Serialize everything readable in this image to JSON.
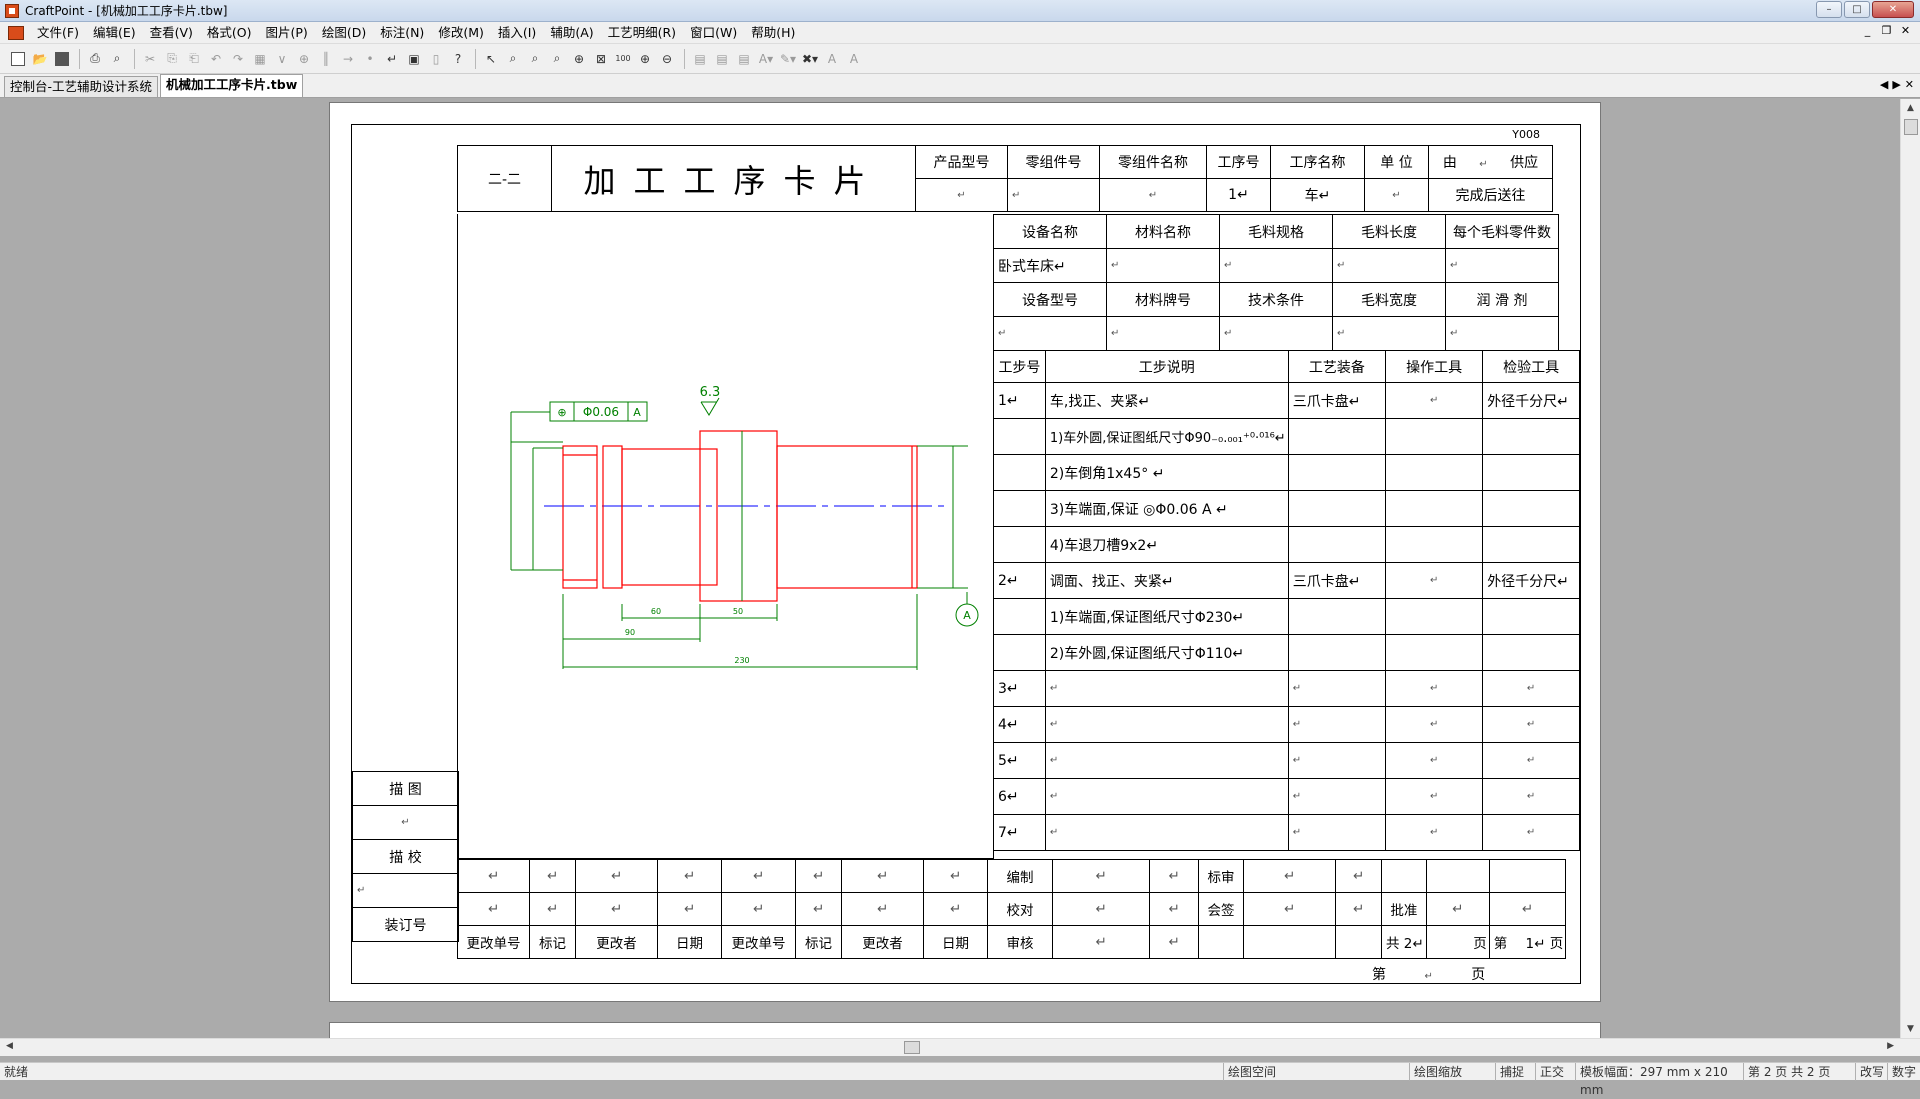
{
  "window": {
    "title": "CraftPoint - [机械加工工序卡片.tbw]"
  },
  "menu": [
    "文件(F)",
    "编辑(E)",
    "查看(V)",
    "格式(O)",
    "图片(P)",
    "绘图(D)",
    "标注(N)",
    "修改(M)",
    "插入(I)",
    "辅助(A)",
    "工艺明细(R)",
    "窗口(W)",
    "帮助(H)"
  ],
  "tabs": [
    "控制台-工艺辅助设计系统",
    "机械加工工序卡片.tbw"
  ],
  "card": {
    "code": "Y008",
    "number": "二-二",
    "title": "加工工序卡片",
    "header_labels": [
      "产品型号",
      "零组件号",
      "零组件名称",
      "工序号",
      "工序名称",
      "单 位"
    ],
    "header_values": [
      "↵",
      "↵",
      "↵",
      "1↵",
      "车↵",
      "↵"
    ],
    "supply_from": "由",
    "supply_to": "供应",
    "complete_note": "完成后送往",
    "equip_labels_1": [
      "设备名称",
      "材料名称",
      "毛料规格",
      "毛料长度",
      "每个毛料零件数"
    ],
    "equip_values_1": [
      "卧式车床↵",
      "↵",
      "↵",
      "↵",
      "↵"
    ],
    "equip_labels_2": [
      "设备型号",
      "材料牌号",
      "技术条件",
      "毛料宽度",
      "润 滑 剂"
    ],
    "equip_values_2": [
      "↵",
      "↵",
      "↵",
      "↵",
      "↵"
    ],
    "step_headers": [
      "工步号",
      "工步说明",
      "工艺装备",
      "操作工具",
      "检验工具"
    ],
    "steps": [
      {
        "no": "1↵",
        "desc": "车,找正、夹紧↵",
        "equip": "三爪卡盘↵",
        "tool": "↵",
        "inspect": "外径千分尺↵"
      },
      {
        "no": "",
        "desc": "1)车外圆,保证图纸尺寸Φ90₋₀.₀₀₁⁺⁰·⁰¹⁶↵",
        "equip": "",
        "tool": "",
        "inspect": ""
      },
      {
        "no": "",
        "desc": "2)车倒角1x45° ↵",
        "equip": "",
        "tool": "",
        "inspect": ""
      },
      {
        "no": "",
        "desc": "3)车端面,保证 ◎Φ0.06 A ↵",
        "equip": "",
        "tool": "",
        "inspect": ""
      },
      {
        "no": "",
        "desc": "4)车退刀槽9x2↵",
        "equip": "",
        "tool": "",
        "inspect": ""
      },
      {
        "no": "2↵",
        "desc": "调面、找正、夹紧↵",
        "equip": "三爪卡盘↵",
        "tool": "↵",
        "inspect": "外径千分尺↵"
      },
      {
        "no": "",
        "desc": "1)车端面,保证图纸尺寸Φ230↵",
        "equip": "",
        "tool": "",
        "inspect": ""
      },
      {
        "no": "",
        "desc": "2)车外圆,保证图纸尺寸Φ110↵",
        "equip": "",
        "tool": "",
        "inspect": ""
      },
      {
        "no": "3↵",
        "desc": "↵",
        "equip": "↵",
        "tool": "↵",
        "inspect": "↵"
      },
      {
        "no": "4↵",
        "desc": "↵",
        "equip": "↵",
        "tool": "↵",
        "inspect": "↵"
      },
      {
        "no": "5↵",
        "desc": "↵",
        "equip": "↵",
        "tool": "↵",
        "inspect": "↵"
      },
      {
        "no": "6↵",
        "desc": "↵",
        "equip": "↵",
        "tool": "↵",
        "inspect": "↵"
      },
      {
        "no": "7↵",
        "desc": "↵",
        "equip": "↵",
        "tool": "↵",
        "inspect": "↵"
      }
    ],
    "stamp": {
      "draw": "描 图",
      "check": "描 校",
      "binding": "装订号"
    },
    "footer": {
      "change_no": "更改单号",
      "mark": "标记",
      "changer": "更改者",
      "date": "日期",
      "compile": "编制",
      "proofread": "校对",
      "audit": "审核",
      "standard": "标审",
      "countersign": "会签",
      "approve": "批准",
      "total_prefix": "共 2↵",
      "page_word": "页",
      "no_prefix": "第",
      "no_value": "1↵",
      "ret": "↵"
    },
    "page_note_prefix": "第",
    "page_note_suffix": "页",
    "drawing": {
      "tolerance_frame": "Φ0.06",
      "datum": "A",
      "roughness": "6.3",
      "dim_60": "60",
      "dim_50": "50",
      "dim_90": "90",
      "dim_230": "230"
    }
  },
  "status": {
    "ready": "就绪",
    "space": "绘图空间",
    "zoom": "绘图缩放",
    "snap": "捕捉",
    "ortho": "正交",
    "template": "模板幅面：297 mm x 210 mm",
    "page": "第 2 页  共 2 页",
    "mode": "改写",
    "num": "数字"
  },
  "colors": {
    "part_outline": "#ff0000",
    "dimension": "#008000",
    "centerline": "#0000ff"
  }
}
